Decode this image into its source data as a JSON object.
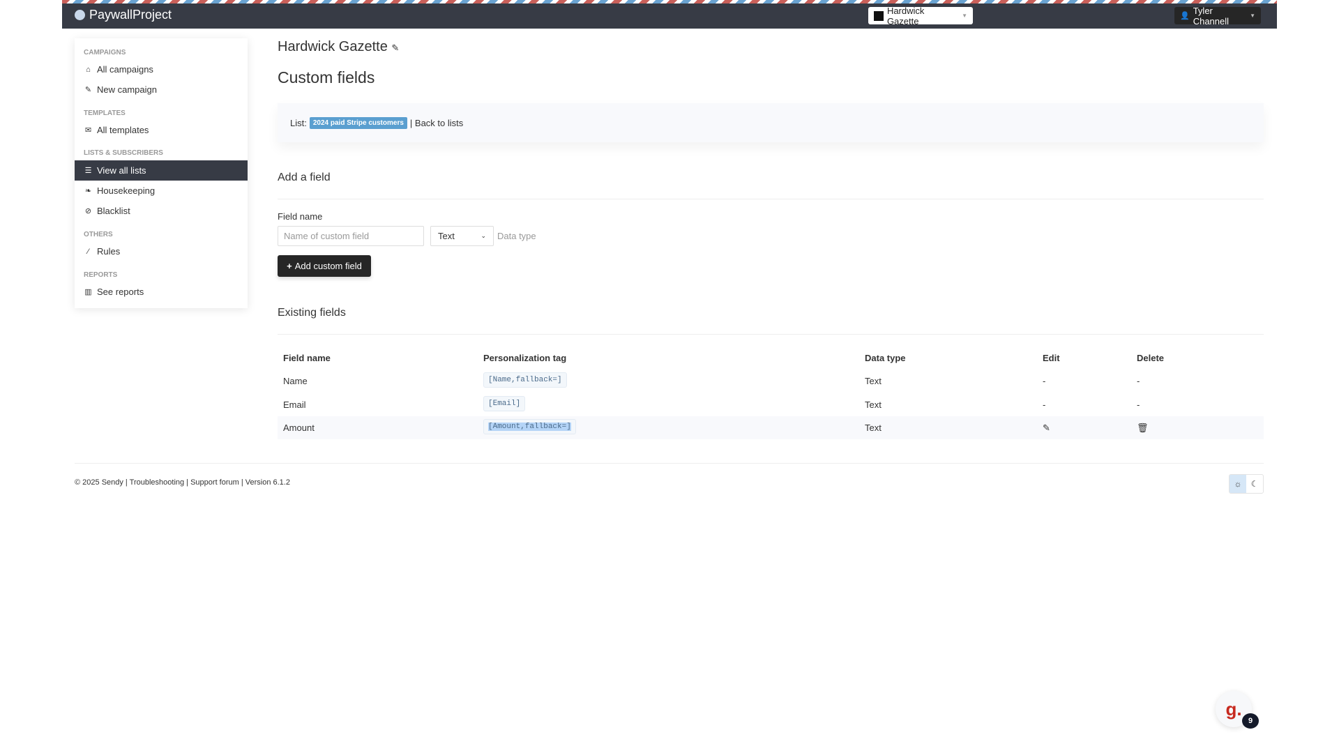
{
  "nav": {
    "brand": "PaywallProject",
    "brand_button": "Hardwick Gazette",
    "user_button": "Tyler Channell"
  },
  "sidebar": {
    "sections": [
      {
        "title": "CAMPAIGNS"
      },
      {
        "title": "TEMPLATES"
      },
      {
        "title": "LISTS & SUBSCRIBERS"
      },
      {
        "title": "OTHERS"
      },
      {
        "title": "REPORTS"
      }
    ],
    "items": [
      {
        "label": "All campaigns",
        "icon": "home-icon"
      },
      {
        "label": "New campaign",
        "icon": "edit-icon"
      },
      {
        "label": "All templates",
        "icon": "envelope-icon"
      },
      {
        "label": "View all lists",
        "icon": "list-icon",
        "active": true
      },
      {
        "label": "Housekeeping",
        "icon": "leaf-icon"
      },
      {
        "label": "Blacklist",
        "icon": "ban-icon"
      },
      {
        "label": "Rules",
        "icon": "magic-wand-icon"
      },
      {
        "label": "See reports",
        "icon": "chart-icon"
      }
    ]
  },
  "main": {
    "brand_title": "Hardwick Gazette",
    "page_title": "Custom fields",
    "list_label": "List:",
    "list_name": "2024 paid Stripe customers",
    "back_link": "| Back to lists",
    "add_heading": "Add a field",
    "field_name_label": "Field name",
    "field_placeholder": "Name of custom field",
    "data_type_value": "Text",
    "data_type_label": "Data type",
    "add_button": "Add custom field",
    "existing_heading": "Existing fields",
    "columns": [
      "Field name",
      "Personalization tag",
      "Data type",
      "Edit",
      "Delete"
    ],
    "rows": [
      {
        "name": "Name",
        "tag": "[Name,fallback=]",
        "type": "Text",
        "edit": "-",
        "delete": "-"
      },
      {
        "name": "Email",
        "tag": "[Email]",
        "type": "Text",
        "edit": "-",
        "delete": "-"
      },
      {
        "name": "Amount",
        "tag": "[Amount,fallback=]",
        "type": "Text",
        "edit": "edit-icon",
        "delete": "trash-icon"
      }
    ]
  },
  "footer": {
    "text": "© 2025 Sendy | Troubleshooting | Support forum | Version 6.1.2"
  },
  "widget": {
    "letter": "g.",
    "badge": "9"
  },
  "colors": {
    "navbar": "#373b45",
    "badge": "#5a9fd0",
    "widget": "#c72a1f"
  }
}
